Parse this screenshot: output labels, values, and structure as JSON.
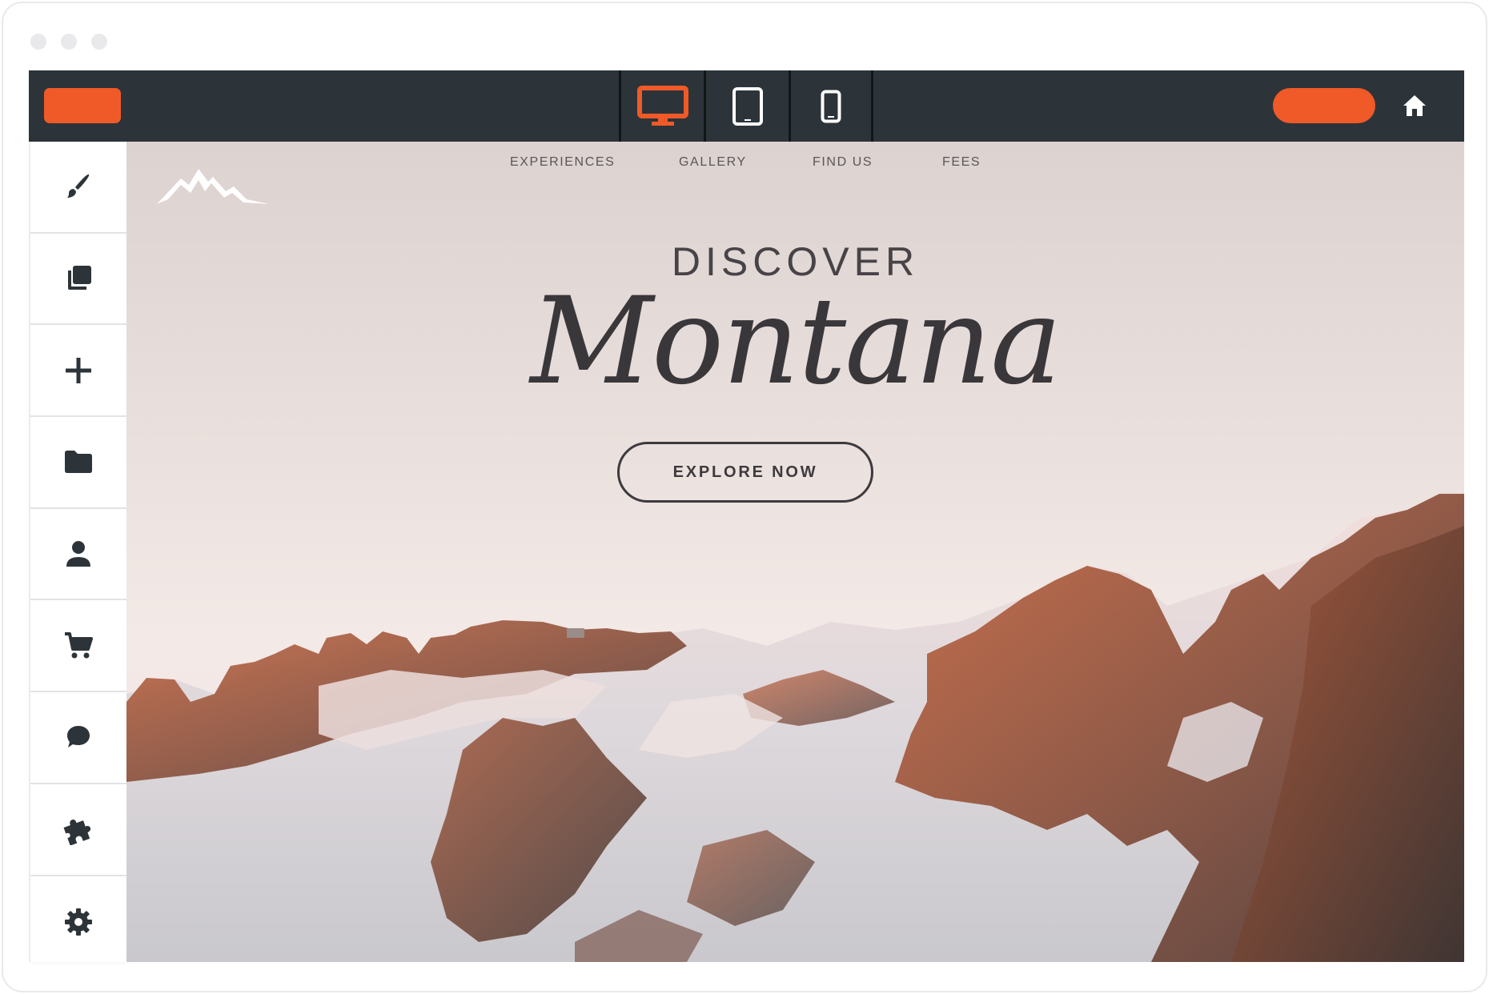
{
  "toolbar": {
    "device_modes": [
      {
        "name": "desktop",
        "icon": "desktop-icon",
        "active": true
      },
      {
        "name": "tablet",
        "icon": "tablet-icon",
        "active": false
      },
      {
        "name": "mobile",
        "icon": "mobile-icon",
        "active": false
      }
    ],
    "home_icon": "home-icon"
  },
  "sidebar": {
    "items": [
      {
        "icon": "brush-icon"
      },
      {
        "icon": "layers-icon"
      },
      {
        "icon": "plus-icon"
      },
      {
        "icon": "folder-icon"
      },
      {
        "icon": "person-icon"
      },
      {
        "icon": "cart-icon"
      },
      {
        "icon": "chat-icon"
      },
      {
        "icon": "puzzle-icon"
      },
      {
        "icon": "gear-icon"
      }
    ]
  },
  "site": {
    "nav": [
      "EXPERIENCES",
      "GALLERY",
      "FIND US",
      "FEES"
    ],
    "hero_kicker": "DISCOVER",
    "hero_title": "Montana",
    "cta_label": "EXPLORE NOW",
    "logo_icon": "mountain-logo-icon"
  },
  "colors": {
    "accent": "#f05a28",
    "toolbar_bg": "#2d3439",
    "icon_dark": "#2d3439"
  }
}
